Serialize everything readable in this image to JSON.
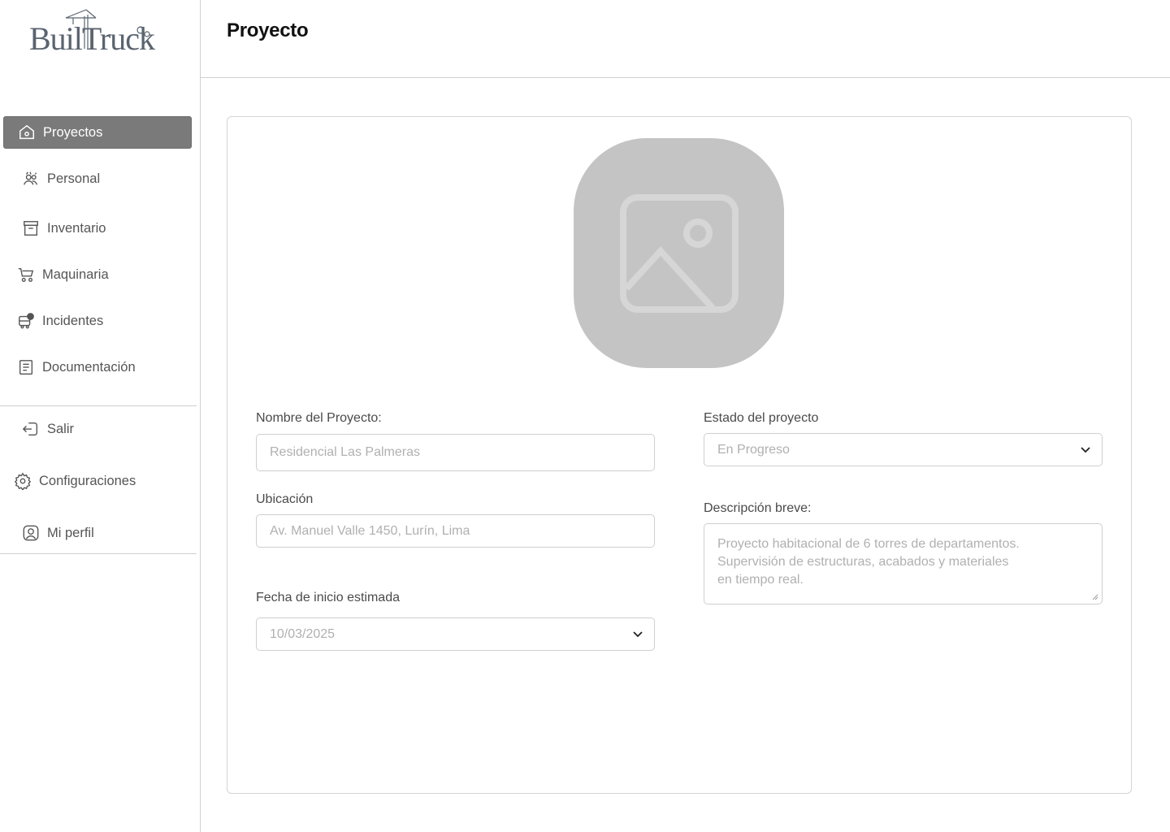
{
  "brand": {
    "name": "BuilTruck"
  },
  "sidebar": {
    "items": [
      {
        "label": "Proyectos",
        "icon": "home-icon",
        "active": true
      },
      {
        "label": "Personal",
        "icon": "workers-icon"
      },
      {
        "label": "Inventario",
        "icon": "archive-icon"
      },
      {
        "label": "Maquinaria",
        "icon": "cart-icon"
      },
      {
        "label": "Incidentes",
        "icon": "truck-alert-icon"
      },
      {
        "label": "Documentación",
        "icon": "document-icon"
      }
    ],
    "bottom_items": [
      {
        "label": "Salir",
        "icon": "logout-icon"
      },
      {
        "label": "Configuraciones",
        "icon": "gear-icon"
      },
      {
        "label": "Mi perfil",
        "icon": "user-icon"
      }
    ]
  },
  "header": {
    "title": "Proyecto"
  },
  "form": {
    "name_label": "Nombre del Proyecto:",
    "name_placeholder": "Residencial Las Palmeras",
    "location_label": "Ubicación",
    "location_placeholder": "Av. Manuel Valle 1450, Lurín, Lima",
    "start_date_label": "Fecha de inicio estimada",
    "start_date_value": "10/03/2025",
    "status_label": "Estado del proyecto",
    "status_value": "En Progreso",
    "description_label": "Descripción breve:",
    "description_placeholder": "Proyecto habitacional de 6 torres de departamentos. Supervisión de estructuras, acabados y materiales en tiempo real."
  },
  "colors": {
    "active_nav": "#7a7a7a",
    "placeholder_bg": "#c4c4c4",
    "border": "#cfcfcf"
  }
}
